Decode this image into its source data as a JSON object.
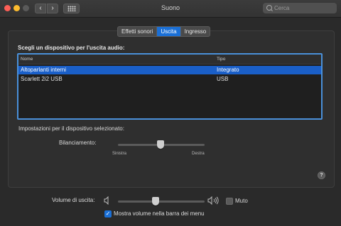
{
  "window": {
    "title": "Suono"
  },
  "toolbar": {
    "back_glyph": "‹",
    "forward_glyph": "›",
    "grid_icon": "show-all-grid-icon"
  },
  "search": {
    "placeholder": "Cerca",
    "value": ""
  },
  "tabs": [
    {
      "label": "Effetti sonori",
      "active": false
    },
    {
      "label": "Uscita",
      "active": true
    },
    {
      "label": "Ingresso",
      "active": false
    }
  ],
  "output": {
    "section_title": "Scegli un dispositivo per l'uscita audio:",
    "columns": [
      "Nome",
      "Tipo"
    ],
    "devices": [
      {
        "name": "Altoparlanti interni",
        "type": "Integrato",
        "selected": true
      },
      {
        "name": "Scarlett 2i2 USB",
        "type": "USB",
        "selected": false
      }
    ],
    "settings_label": "Impostazioni per il dispositivo selezionato:",
    "balance_label": "Bilanciamento:",
    "balance_left": "Sinistra",
    "balance_right": "Destra",
    "balance_value": 0.5
  },
  "help_glyph": "?",
  "footer": {
    "volume_label": "Volume di uscita:",
    "volume_value": 0.4,
    "mute_label": "Muto",
    "mute_checked": false,
    "show_in_menu_label": "Mostra volume nella barra dei menu",
    "show_in_menu_checked": true
  },
  "colors": {
    "accent": "#1a6fd6",
    "selection": "#1a5fc8",
    "window_bg": "#2a2a2a"
  }
}
